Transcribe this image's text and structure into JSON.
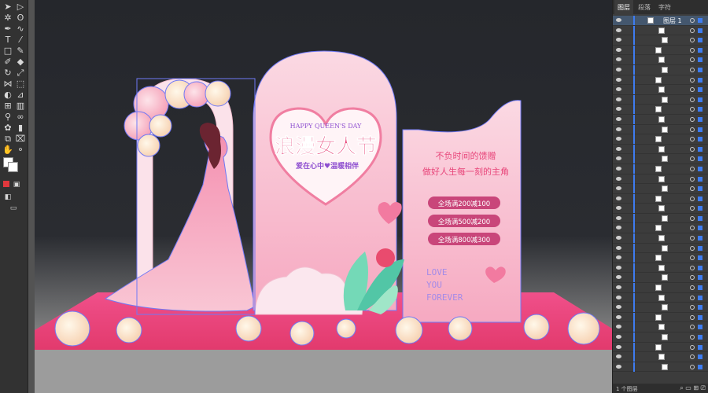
{
  "panel": {
    "tabs": [
      "图层",
      "段落",
      "字符"
    ],
    "top_layer_name": "图层 1",
    "status": "1 个图层"
  },
  "design": {
    "headline_en": "HAPPY QUEEN'S DAY",
    "headline_cn": "浪漫女人节",
    "tagline": "爱在心中♥温暖相伴",
    "slogan_line1": "不负时间的馈赠",
    "slogan_line2": "做好人生每一刻的主角",
    "coupons": [
      "全场满200减100",
      "全场满500减200",
      "全场满800减300"
    ],
    "love_lines": [
      "LOVE",
      "YOU",
      "FOREVER"
    ]
  },
  "colors": {
    "pink_light": "#f9d7e1",
    "pink_mid": "#f5a9c0",
    "pink_deep": "#e8457a",
    "selection_blue": "#6f79f6"
  },
  "icons": {
    "tools": [
      "selection-tool",
      "direct-selection-tool",
      "magic-wand-tool",
      "lasso-tool",
      "pen-tool",
      "curvature-tool",
      "type-tool",
      "line-tool",
      "rectangle-tool",
      "paintbrush-tool",
      "shaper-tool",
      "eraser-tool",
      "rotate-tool",
      "scale-tool",
      "width-tool",
      "free-transform-tool",
      "shape-builder-tool",
      "perspective-tool",
      "mesh-tool",
      "gradient-tool",
      "eyedropper-tool",
      "blend-tool",
      "symbol-sprayer-tool",
      "graph-tool",
      "artboard-tool",
      "slice-tool",
      "hand-tool",
      "zoom-tool"
    ]
  }
}
